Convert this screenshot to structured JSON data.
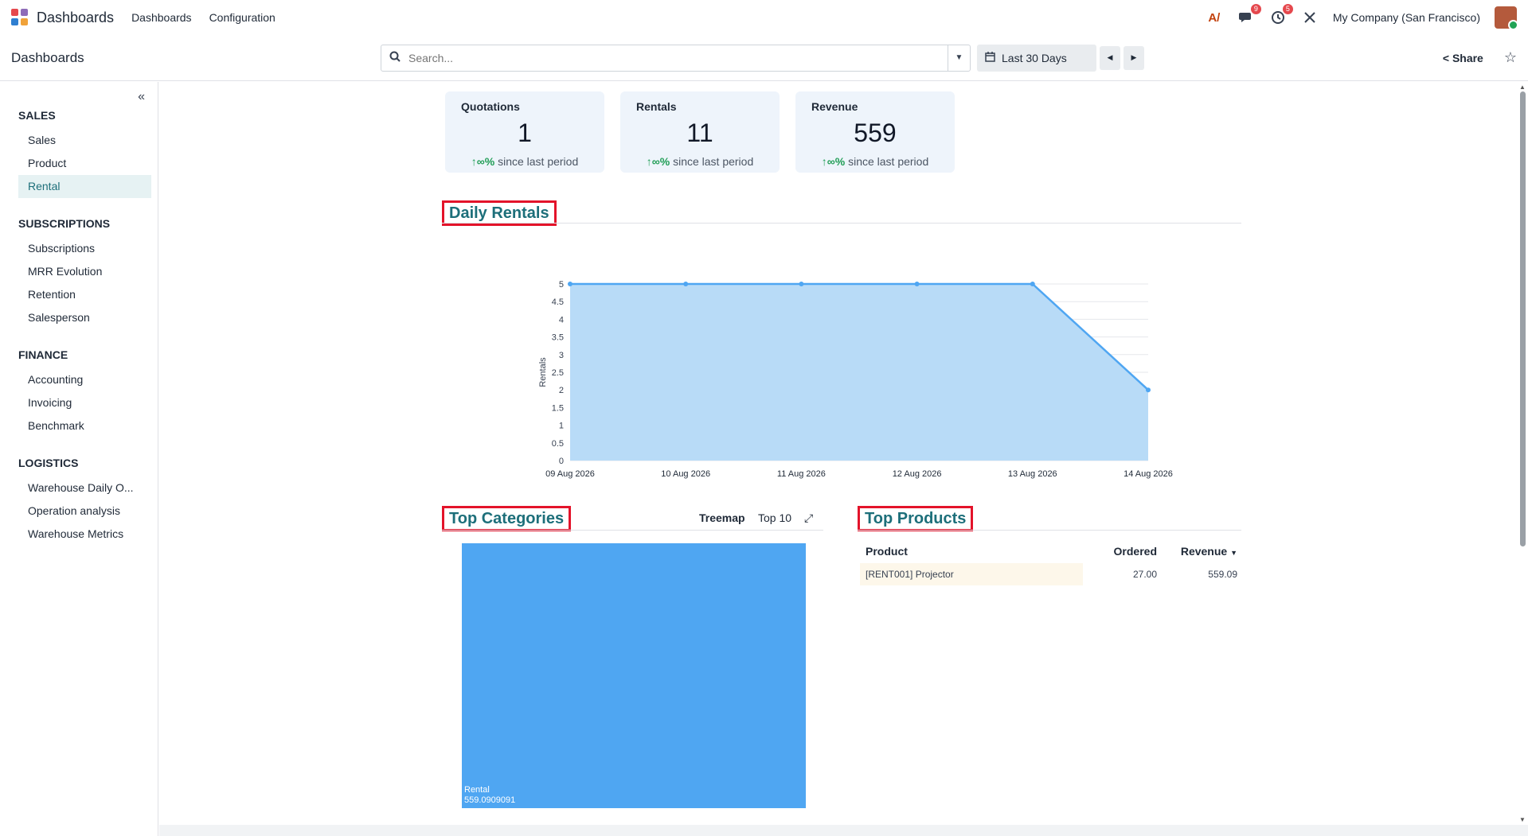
{
  "navbar": {
    "app_name": "Dashboards",
    "menus": [
      "Dashboards",
      "Configuration"
    ],
    "messages_badge": "9",
    "activity_badge": "5",
    "company": "My Company (San Francisco)"
  },
  "control": {
    "breadcrumb": "Dashboards",
    "search_placeholder": "Search...",
    "date_filter": "Last 30 Days",
    "share_label": "Share"
  },
  "sidebar": {
    "sections": [
      {
        "title": "SALES",
        "items": [
          "Sales",
          "Product",
          "Rental"
        ]
      },
      {
        "title": "SUBSCRIPTIONS",
        "items": [
          "Subscriptions",
          "MRR Evolution",
          "Retention",
          "Salesperson"
        ]
      },
      {
        "title": "FINANCE",
        "items": [
          "Accounting",
          "Invoicing",
          "Benchmark"
        ]
      },
      {
        "title": "LOGISTICS",
        "items": [
          "Warehouse Daily O...",
          "Operation analysis",
          "Warehouse Metrics"
        ]
      }
    ],
    "active_item": "Rental"
  },
  "kpis": [
    {
      "title": "Quotations",
      "value": "1",
      "trend": "∞%",
      "trend_text": "since last period"
    },
    {
      "title": "Rentals",
      "value": "11",
      "trend": "∞%",
      "trend_text": "since last period"
    },
    {
      "title": "Revenue",
      "value": "559",
      "trend": "∞%",
      "trend_text": "since last period"
    }
  ],
  "sections": {
    "daily_rentals": "Daily Rentals",
    "top_categories": "Top Categories",
    "top_products": "Top Products",
    "treemap_label": "Treemap",
    "top_n_label": "Top 10"
  },
  "chart_data": {
    "type": "area",
    "x": [
      "09 Aug 2026",
      "10 Aug 2026",
      "11 Aug 2026",
      "12 Aug 2026",
      "13 Aug 2026",
      "14 Aug 2026"
    ],
    "series": [
      {
        "values": [
          5,
          5,
          5,
          5,
          5,
          2
        ]
      }
    ],
    "ylabel": "Rentals",
    "ylim": [
      0,
      5
    ],
    "yticks": [
      "0",
      "0.5",
      "1",
      "1.5",
      "2",
      "2.5",
      "3",
      "3.5",
      "4",
      "4.5",
      "5"
    ],
    "grid": true,
    "line_color": "#4fa6f2",
    "fill_color": "#b8dbf7"
  },
  "treemap": {
    "category": "Rental",
    "value": "559.0909091",
    "color": "#4fa6f2"
  },
  "top_products": {
    "headers": [
      "Product",
      "Ordered",
      "Revenue"
    ],
    "rows": [
      {
        "product": "[RENT001] Projector",
        "ordered": "27.00",
        "revenue": "559.09"
      }
    ]
  }
}
